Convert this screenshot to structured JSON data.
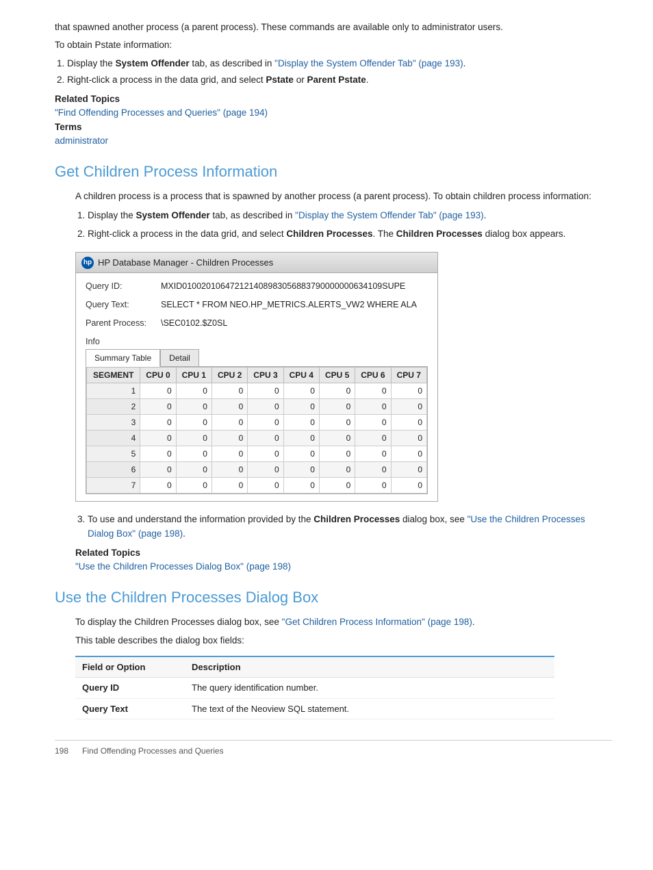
{
  "intro": {
    "para1": "that spawned another process (a parent process). These commands are available only to administrator users.",
    "para2": "To obtain Pstate information:",
    "steps": [
      {
        "text_before": "Display the ",
        "bold": "System Offender",
        "text_after": " tab, as described in ",
        "link": "\"Display the System Offender Tab\" (page 193)",
        "link_href": "#"
      },
      {
        "text_before": "Right-click a process in the data grid, and select ",
        "bold1": "Pstate",
        "text_mid": " or ",
        "bold2": "Parent Pstate",
        "text_after": "."
      }
    ],
    "related_topics_label": "Related Topics",
    "related_topics_link": "\"Find Offending Processes and Queries\" (page 194)",
    "terms_label": "Terms",
    "terms_link": "administrator"
  },
  "section1": {
    "heading": "Get Children Process Information",
    "para1": "A children process is a process that is spawned by another process (a parent process). To obtain children process information:",
    "steps": [
      {
        "text_before": "Display the ",
        "bold": "System Offender",
        "text_after": " tab, as described in ",
        "link": "\"Display the System Offender Tab\" (page 193)",
        "link_href": "#"
      },
      {
        "text_before": "Right-click a process in the data grid, and select ",
        "bold1": "Children Processes",
        "text_mid": ". The ",
        "bold2": "Children Processes",
        "text_after": " dialog box appears."
      }
    ],
    "dialog": {
      "title": "HP Database Manager - Children Processes",
      "logo_text": "hp",
      "fields": [
        {
          "label": "Query ID:",
          "value": "MXID010020106472121408983056883790000000634109SUPE"
        },
        {
          "label": "Query Text:",
          "value": "SELECT * FROM NEO.HP_METRICS.ALERTS_VW2 WHERE ALA"
        },
        {
          "label": "Parent Process:",
          "value": "\\SEC0102.$Z0SL"
        }
      ],
      "info_label": "Info",
      "tabs": [
        "Summary Table",
        "Detail"
      ],
      "active_tab": 0,
      "table": {
        "headers": [
          "SEGMENT",
          "CPU 0",
          "CPU 1",
          "CPU 2",
          "CPU 3",
          "CPU 4",
          "CPU 5",
          "CPU 6",
          "CPU 7"
        ],
        "rows": [
          [
            1,
            0,
            0,
            0,
            0,
            0,
            0,
            0,
            0
          ],
          [
            2,
            0,
            0,
            0,
            0,
            0,
            0,
            0,
            0
          ],
          [
            3,
            0,
            0,
            0,
            0,
            0,
            0,
            0,
            0
          ],
          [
            4,
            0,
            0,
            0,
            0,
            0,
            0,
            0,
            0
          ],
          [
            5,
            0,
            0,
            0,
            0,
            0,
            0,
            0,
            0
          ],
          [
            6,
            0,
            0,
            0,
            0,
            0,
            0,
            0,
            0
          ],
          [
            7,
            0,
            0,
            0,
            0,
            0,
            0,
            0,
            0
          ]
        ]
      }
    },
    "step3_before": "To use and understand the information provided by the ",
    "step3_bold": "Children Processes",
    "step3_mid": " dialog box, see ",
    "step3_link": "\"Use the Children Processes Dialog Box\" (page 198)",
    "step3_after": ".",
    "related_topics_label": "Related Topics",
    "related_topics_link": "\"Use the Children Processes Dialog Box\" (page 198)"
  },
  "section2": {
    "heading": "Use the Children Processes Dialog Box",
    "para1_before": "To display the Children Processes dialog box, see ",
    "para1_link": "\"Get Children Process Information\" (page 198)",
    "para1_after": ".",
    "para2": "This table describes the dialog box fields:",
    "table": {
      "headers": [
        "Field or Option",
        "Description"
      ],
      "rows": [
        {
          "field": "Query ID",
          "description": "The query identification number."
        },
        {
          "field": "Query Text",
          "description": "The text of the Neoview SQL statement."
        }
      ]
    }
  },
  "footer": {
    "page_number": "198",
    "text": "Find Offending Processes and Queries"
  }
}
